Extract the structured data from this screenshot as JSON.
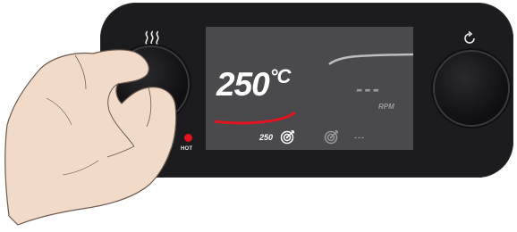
{
  "panel": {
    "heater_icon": "heat-waves-icon",
    "rotation_icon": "rotate-icon",
    "hot_indicator_label": "HOT",
    "colors": {
      "body": "#1c1c1e",
      "screen": "#4a4a4d",
      "accent_red": "#e3141f",
      "text_white": "#ffffff",
      "text_grey": "#9a9a9e"
    }
  },
  "display": {
    "temperature_value": "250",
    "temperature_unit": "°C",
    "temperature_setpoint": "250",
    "speed_value": "---",
    "speed_unit": "RPM",
    "speed_setpoint": "---",
    "target_icon": "target-icon"
  }
}
